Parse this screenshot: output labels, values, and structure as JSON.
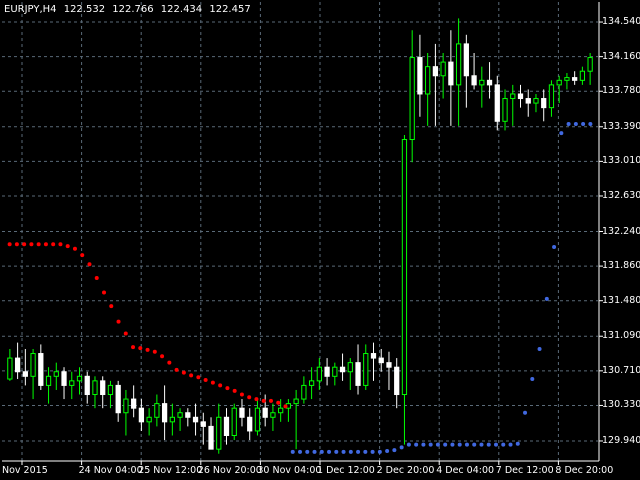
{
  "header": {
    "symbol_timeframe": "EURJPY,H4",
    "open": "122.532",
    "high": "122.766",
    "low": "122.434",
    "close": "122.457"
  },
  "colors": {
    "background": "#000000",
    "grid": "#5a6a78",
    "axis": "#ffffff",
    "bull_candle": "#00ff00",
    "bear_candle": "#ffffff",
    "sar_high": "#ff0000",
    "sar_low": "#4169e1"
  },
  "chart_data": {
    "type": "candlestick",
    "symbol": "EURJPY",
    "timeframe": "H4",
    "indicator": "Parabolic SAR",
    "grid": true,
    "ylim": [
      129.72,
      134.76
    ],
    "y_ticks": [
      "134.540",
      "134.160",
      "133.780",
      "133.390",
      "133.010",
      "132.630",
      "132.240",
      "131.860",
      "131.480",
      "131.090",
      "130.710",
      "130.330",
      "129.940"
    ],
    "x_ticks": [
      "Nov 2015",
      "24 Nov 04:00",
      "25 Nov 12:00",
      "26 Nov 20:00",
      "30 Nov 04:00",
      "1 Dec 12:00",
      "2 Dec 20:00",
      "4 Dec 04:00",
      "7 Dec 12:00",
      "8 Dec 20:00"
    ],
    "candles": [
      [
        130.62,
        130.95,
        130.6,
        130.85
      ],
      [
        130.85,
        131.02,
        130.62,
        130.7
      ],
      [
        130.7,
        130.95,
        130.55,
        130.65
      ],
      [
        130.65,
        130.95,
        130.4,
        130.9
      ],
      [
        130.9,
        131.0,
        130.5,
        130.55
      ],
      [
        130.55,
        130.75,
        130.35,
        130.65
      ],
      [
        130.65,
        130.8,
        130.5,
        130.7
      ],
      [
        130.7,
        130.75,
        130.4,
        130.55
      ],
      [
        130.55,
        130.7,
        130.4,
        130.6
      ],
      [
        130.6,
        130.75,
        130.45,
        130.65
      ],
      [
        130.65,
        130.7,
        130.35,
        130.45
      ],
      [
        130.45,
        130.65,
        130.3,
        130.6
      ],
      [
        130.6,
        130.65,
        130.3,
        130.45
      ],
      [
        130.45,
        130.6,
        130.3,
        130.55
      ],
      [
        130.55,
        130.6,
        130.15,
        130.25
      ],
      [
        130.25,
        130.5,
        130.0,
        130.4
      ],
      [
        130.4,
        130.55,
        130.2,
        130.3
      ],
      [
        130.3,
        130.4,
        130.05,
        130.15
      ],
      [
        130.15,
        130.3,
        130.0,
        130.2
      ],
      [
        130.2,
        130.45,
        130.1,
        130.35
      ],
      [
        130.35,
        130.55,
        129.95,
        130.15
      ],
      [
        130.15,
        130.35,
        130.0,
        130.2
      ],
      [
        130.2,
        130.3,
        130.05,
        130.25
      ],
      [
        130.25,
        130.3,
        130.1,
        130.2
      ],
      [
        130.2,
        130.35,
        130.0,
        130.15
      ],
      [
        130.15,
        130.25,
        129.9,
        130.1
      ],
      [
        130.1,
        130.2,
        129.95,
        129.85
      ],
      [
        129.85,
        130.35,
        129.8,
        130.2
      ],
      [
        130.2,
        130.3,
        129.9,
        130.0
      ],
      [
        130.0,
        130.35,
        129.95,
        130.3
      ],
      [
        130.3,
        130.4,
        130.1,
        130.2
      ],
      [
        130.2,
        130.3,
        129.95,
        130.05
      ],
      [
        130.05,
        130.4,
        130.0,
        130.3
      ],
      [
        130.3,
        130.45,
        130.1,
        130.2
      ],
      [
        130.2,
        130.35,
        130.05,
        130.25
      ],
      [
        130.25,
        130.4,
        130.15,
        130.3
      ],
      [
        130.3,
        130.4,
        130.15,
        130.35
      ],
      [
        130.35,
        130.5,
        129.85,
        130.4
      ],
      [
        130.4,
        130.65,
        130.35,
        130.55
      ],
      [
        130.55,
        130.75,
        130.4,
        130.6
      ],
      [
        130.6,
        130.85,
        130.5,
        130.75
      ],
      [
        130.75,
        130.85,
        130.55,
        130.65
      ],
      [
        130.65,
        130.8,
        130.55,
        130.75
      ],
      [
        130.75,
        130.9,
        130.6,
        130.7
      ],
      [
        130.7,
        130.85,
        130.5,
        130.8
      ],
      [
        130.8,
        131.0,
        130.45,
        130.55
      ],
      [
        130.55,
        131.0,
        130.5,
        130.9
      ],
      [
        130.9,
        131.02,
        130.6,
        130.85
      ],
      [
        130.85,
        130.95,
        130.7,
        130.8
      ],
      [
        130.8,
        130.92,
        130.5,
        130.75
      ],
      [
        130.75,
        130.85,
        130.3,
        130.45
      ],
      [
        130.45,
        133.3,
        129.9,
        133.25
      ],
      [
        133.25,
        134.45,
        133.0,
        134.15
      ],
      [
        134.15,
        134.4,
        133.5,
        133.75
      ],
      [
        133.75,
        134.2,
        133.4,
        134.05
      ],
      [
        134.05,
        134.3,
        133.4,
        133.95
      ],
      [
        133.95,
        134.2,
        133.7,
        134.1
      ],
      [
        134.1,
        134.45,
        133.4,
        133.85
      ],
      [
        133.85,
        134.58,
        133.4,
        134.3
      ],
      [
        134.3,
        134.4,
        133.6,
        133.95
      ],
      [
        133.95,
        134.2,
        133.8,
        133.85
      ],
      [
        133.85,
        134.05,
        133.6,
        133.9
      ],
      [
        133.9,
        134.1,
        133.7,
        133.85
      ],
      [
        133.85,
        133.95,
        133.35,
        133.45
      ],
      [
        133.45,
        133.8,
        133.35,
        133.7
      ],
      [
        133.7,
        133.85,
        133.4,
        133.75
      ],
      [
        133.75,
        133.85,
        133.6,
        133.7
      ],
      [
        133.7,
        133.8,
        133.5,
        133.65
      ],
      [
        133.65,
        133.75,
        133.55,
        133.7
      ],
      [
        133.7,
        133.8,
        133.45,
        133.6
      ],
      [
        133.6,
        133.9,
        133.5,
        133.85
      ],
      [
        133.85,
        133.95,
        133.65,
        133.9
      ],
      [
        133.9,
        133.98,
        133.8,
        133.93
      ],
      [
        133.93,
        134.0,
        133.85,
        133.9
      ],
      [
        133.9,
        134.05,
        133.85,
        134.0
      ],
      [
        134.0,
        134.2,
        133.85,
        134.15
      ]
    ],
    "sar": [
      [
        132.1,
        "high"
      ],
      [
        132.1,
        "high"
      ],
      [
        132.1,
        "high"
      ],
      [
        132.1,
        "high"
      ],
      [
        132.1,
        "high"
      ],
      [
        132.1,
        "high"
      ],
      [
        132.1,
        "high"
      ],
      [
        132.1,
        "high"
      ],
      [
        132.08,
        "high"
      ],
      [
        132.05,
        "high"
      ],
      [
        131.98,
        "high"
      ],
      [
        131.88,
        "high"
      ],
      [
        131.73,
        "high"
      ],
      [
        131.57,
        "high"
      ],
      [
        131.42,
        "high"
      ],
      [
        131.25,
        "high"
      ],
      [
        131.12,
        "high"
      ],
      [
        130.97,
        "high"
      ],
      [
        130.96,
        "high"
      ],
      [
        130.94,
        "high"
      ],
      [
        130.92,
        "high"
      ],
      [
        130.87,
        "high"
      ],
      [
        130.8,
        "high"
      ],
      [
        130.72,
        "high"
      ],
      [
        130.69,
        "high"
      ],
      [
        130.66,
        "high"
      ],
      [
        130.64,
        "high"
      ],
      [
        130.61,
        "high"
      ],
      [
        130.58,
        "high"
      ],
      [
        130.55,
        "high"
      ],
      [
        130.52,
        "high"
      ],
      [
        130.49,
        "high"
      ],
      [
        130.45,
        "high"
      ],
      [
        130.42,
        "high"
      ],
      [
        130.4,
        "high"
      ],
      [
        130.38,
        "high"
      ],
      [
        130.38,
        "high"
      ],
      [
        130.36,
        "high"
      ],
      [
        130.32,
        "high"
      ],
      [
        129.82,
        "low"
      ],
      [
        129.82,
        "low"
      ],
      [
        129.82,
        "low"
      ],
      [
        129.82,
        "low"
      ],
      [
        129.82,
        "low"
      ],
      [
        129.82,
        "low"
      ],
      [
        129.82,
        "low"
      ],
      [
        129.82,
        "low"
      ],
      [
        129.82,
        "low"
      ],
      [
        129.82,
        "low"
      ],
      [
        129.82,
        "low"
      ],
      [
        129.82,
        "low"
      ],
      [
        129.82,
        "low"
      ],
      [
        129.83,
        "low"
      ],
      [
        129.84,
        "low"
      ],
      [
        129.87,
        "low"
      ],
      [
        129.9,
        "low"
      ],
      [
        129.9,
        "low"
      ],
      [
        129.9,
        "low"
      ],
      [
        129.9,
        "low"
      ],
      [
        129.9,
        "low"
      ],
      [
        129.9,
        "low"
      ],
      [
        129.9,
        "low"
      ],
      [
        129.9,
        "low"
      ],
      [
        129.9,
        "low"
      ],
      [
        129.9,
        "low"
      ],
      [
        129.9,
        "low"
      ],
      [
        129.9,
        "low"
      ],
      [
        129.9,
        "low"
      ],
      [
        129.9,
        "low"
      ],
      [
        129.9,
        "low"
      ],
      [
        129.91,
        "low"
      ],
      [
        130.25,
        "low"
      ],
      [
        130.62,
        "low"
      ],
      [
        130.95,
        "low"
      ],
      [
        131.5,
        "low"
      ],
      [
        132.07,
        "low"
      ],
      [
        133.32,
        "low"
      ],
      [
        133.42,
        "low"
      ],
      [
        133.42,
        "low"
      ],
      [
        133.42,
        "low"
      ],
      [
        133.42,
        "low"
      ]
    ]
  }
}
